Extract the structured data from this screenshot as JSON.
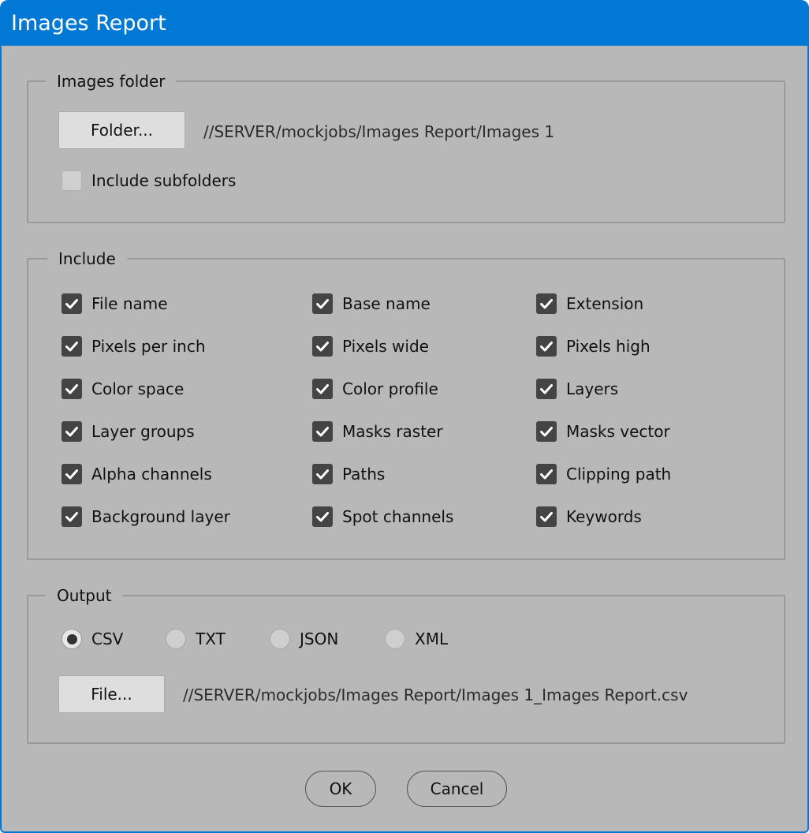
{
  "window": {
    "title": "Images Report",
    "accent_color": "#0078d4",
    "background_color": "#b8b8b8"
  },
  "images_folder": {
    "legend": "Images folder",
    "folder_button": "Folder...",
    "path": "//SERVER/mockjobs/Images Report/Images 1",
    "include_subfolders": {
      "label": "Include subfolders",
      "checked": false
    }
  },
  "include": {
    "legend": "Include",
    "columns": [
      [
        {
          "label": "File name",
          "checked": true
        },
        {
          "label": "Pixels per inch",
          "checked": true
        },
        {
          "label": "Color space",
          "checked": true
        },
        {
          "label": "Layer groups",
          "checked": true
        },
        {
          "label": "Alpha channels",
          "checked": true
        },
        {
          "label": "Background layer",
          "checked": true
        }
      ],
      [
        {
          "label": "Base name",
          "checked": true
        },
        {
          "label": "Pixels wide",
          "checked": true
        },
        {
          "label": "Color profile",
          "checked": true
        },
        {
          "label": "Masks raster",
          "checked": true
        },
        {
          "label": "Paths",
          "checked": true
        },
        {
          "label": "Spot channels",
          "checked": true
        }
      ],
      [
        {
          "label": "Extension",
          "checked": true
        },
        {
          "label": "Pixels high",
          "checked": true
        },
        {
          "label": "Layers",
          "checked": true
        },
        {
          "label": "Masks vector",
          "checked": true
        },
        {
          "label": "Clipping path",
          "checked": true
        },
        {
          "label": "Keywords",
          "checked": true
        }
      ]
    ]
  },
  "output": {
    "legend": "Output",
    "formats": [
      {
        "label": "CSV",
        "selected": true
      },
      {
        "label": "TXT",
        "selected": false
      },
      {
        "label": "JSON",
        "selected": false
      },
      {
        "label": "XML",
        "selected": false
      }
    ],
    "file_button": "File...",
    "path": "//SERVER/mockjobs/Images Report/Images 1_Images Report.csv"
  },
  "actions": {
    "ok": "OK",
    "cancel": "Cancel"
  },
  "icons": {
    "checkmark": "check-icon"
  }
}
